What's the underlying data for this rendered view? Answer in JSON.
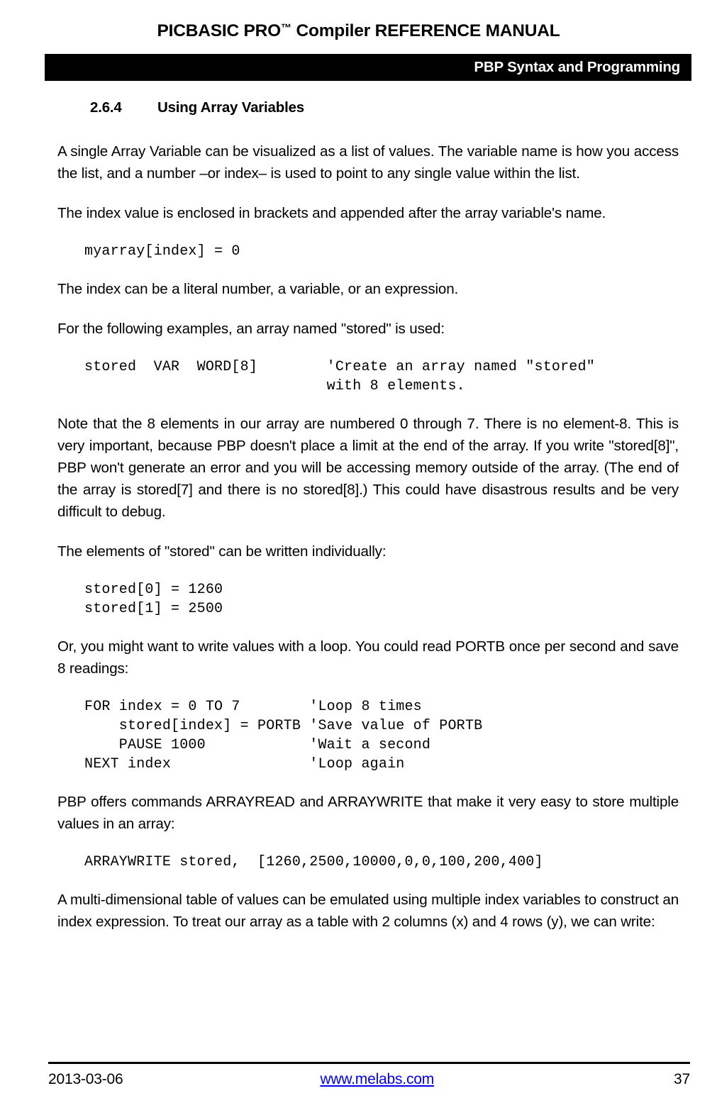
{
  "header": {
    "doc_title_before_tm": "PICBASIC PRO",
    "trademark_symbol": "™",
    "doc_title_after_tm": " Compiler REFERENCE MANUAL",
    "bar_text": "PBP Syntax and Programming"
  },
  "section": {
    "number": "2.6.4",
    "title": "Using Array Variables"
  },
  "body": {
    "para1": "A single Array Variable can be visualized as a list of values.  The variable name is how you access the list, and a number –or index– is used to point to any single value within the list.",
    "para2": "The index value is enclosed in brackets and appended after the array variable's name.",
    "code1": "myarray[index] = 0",
    "para3": "The index can be a literal number, a variable, or an expression.",
    "para4": "For the following examples, an array named \"stored\" is used:",
    "code2": "stored  VAR  WORD[8]        'Create an array named \"stored\"\n                            with 8 elements.",
    "para5": "Note that the 8 elements in our array are numbered 0 through 7.  There is no element-8.  This is very important, because PBP doesn't place a limit at the end of the array.  If you write \"stored[8]\", PBP won't generate an error and you will be accessing memory outside of the array.  (The end of the array is stored[7] and there is no stored[8].)  This could have disastrous results and be very difficult to debug.",
    "para6": "The elements of \"stored\" can be written individually:",
    "code3": "stored[0] = 1260\nstored[1] = 2500",
    "para7": "Or, you might want to write values with a loop.  You could read PORTB once per second and save 8 readings:",
    "code4": "FOR index = 0 TO 7        'Loop 8 times\n    stored[index] = PORTB 'Save value of PORTB\n    PAUSE 1000            'Wait a second\nNEXT index                'Loop again",
    "para8": "PBP offers commands ARRAYREAD and ARRAYWRITE that make it very easy to store multiple values in an array:",
    "code5": "ARRAYWRITE stored,  [1260,2500,10000,0,0,100,200,400]",
    "para9": "A multi-dimensional table of values can be emulated using multiple index variables to construct an index expression.  To treat our array as a table with 2 columns (x) and 4 rows (y), we can write:"
  },
  "footer": {
    "date": "2013-03-06",
    "link_text": "www.melabs.com",
    "page_number": "37"
  },
  "colors": {
    "text": "#000000",
    "bar_background": "#000000",
    "bar_text": "#ffffff",
    "link": "#0000ee",
    "page_background": "#ffffff"
  }
}
